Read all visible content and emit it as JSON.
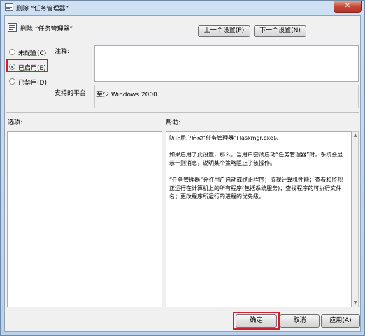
{
  "window": {
    "title": "删除 “任务管理器”"
  },
  "header": {
    "policy_name": "删除 “任务管理器”"
  },
  "nav": {
    "prev_label": "上一个设置(P)",
    "next_label": "下一个设置(N)"
  },
  "state": {
    "options": [
      {
        "label": "未配置(C)",
        "selected": false
      },
      {
        "label": "已启用(E)",
        "selected": true
      },
      {
        "label": "已禁用(D)",
        "selected": false
      }
    ]
  },
  "note": {
    "label": "注释:",
    "value": ""
  },
  "platform": {
    "label": "支持的平台:",
    "value": "至少 Windows 2000"
  },
  "sections": {
    "options_label": "选项:",
    "help_label": "帮助:"
  },
  "help": {
    "paragraphs": [
      "防止用户启动“任务管理器”(Taskmgr.exe)。",
      "如果启用了此设置，那么，当用户尝试启动“任务管理器”时，系统会显示一则消息，说明某个策略阻止了该操作。",
      "“任务管理器”允许用户启动或终止程序；监视计算机性能；查看和监视正运行在计算机上的所有程序(包括系统服务)；查找程序的可执行文件名；更改程序所运行的进程的优先级。"
    ]
  },
  "footer": {
    "ok_label": "确定",
    "cancel_label": "取消",
    "apply_label": "应用(A)"
  },
  "highlight_color": "#d21f2b"
}
